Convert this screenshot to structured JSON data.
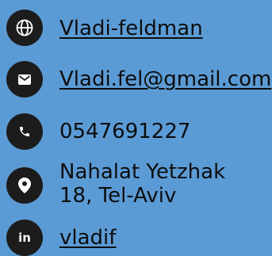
{
  "contacts": {
    "website": {
      "label": "Vladi-feldman",
      "icon": "globe-icon"
    },
    "email": {
      "label": "Vladi.fel@gmail.com",
      "icon": "envelope-icon"
    },
    "phone": {
      "label": "0547691227",
      "icon": "phone-icon"
    },
    "address": {
      "line1": "Nahalat Yetzhak",
      "line2": "18, Tel-Aviv",
      "icon": "location-pin-icon"
    },
    "linkedin": {
      "label": "vladif",
      "icon": "linkedin-icon",
      "icon_text": "in"
    }
  },
  "colors": {
    "background": "#5b9bd5",
    "badge": "#1c1c1c",
    "text": "#0d0d0d"
  }
}
